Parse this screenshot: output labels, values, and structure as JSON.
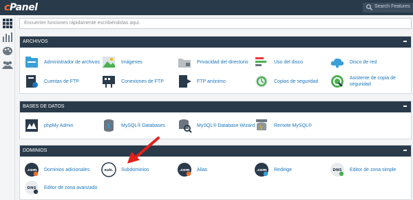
{
  "topbar": {
    "logo": "cPanel",
    "search_placeholder": "Search Features"
  },
  "main_search": {
    "placeholder": "Encuentre funciones rápidamente escribiéndolas aquí."
  },
  "sections": [
    {
      "title": "ARCHIVOS",
      "items": [
        {
          "label": "Administrador de archivos",
          "icon": "file-manager-icon"
        },
        {
          "label": "Imágenes",
          "icon": "images-icon"
        },
        {
          "label": "Privacidad del directorio",
          "icon": "folder-privacy-icon"
        },
        {
          "label": "Uso del disco",
          "icon": "disk-usage-icon"
        },
        {
          "label": "Disco de red",
          "icon": "cloud-disk-icon"
        },
        {
          "label": "Cuentas de FTP",
          "icon": "ftp-accounts-icon"
        },
        {
          "label": "Conexiones de FTP",
          "icon": "ftp-connections-icon"
        },
        {
          "label": "FTP anónimo",
          "icon": "anonymous-ftp-icon"
        },
        {
          "label": "Copias de seguridad",
          "icon": "backup-icon"
        },
        {
          "label": "Asistente de copia de seguridad",
          "icon": "backup-wizard-icon"
        }
      ]
    },
    {
      "title": "BASES DE DATOS",
      "items": [
        {
          "label": "phpMy Admin",
          "icon": "phpmyadmin-icon"
        },
        {
          "label": "MySQL® Databases",
          "icon": "mysql-databases-icon"
        },
        {
          "label": "MySQL® Database Wizard",
          "icon": "mysql-wizard-icon"
        },
        {
          "label": "Remote MySQL®",
          "icon": "remote-mysql-icon"
        }
      ]
    },
    {
      "title": "DOMINIOS",
      "items": [
        {
          "label": "Dominios adicionales",
          "icon": "addon-domains-icon",
          "badge": ".com"
        },
        {
          "label": "Subdominios",
          "icon": "subdomains-icon",
          "badge": "sub."
        },
        {
          "label": "Alias",
          "icon": "aliases-icon",
          "badge": ".com"
        },
        {
          "label": "Redirige",
          "icon": "redirects-icon",
          "badge": ".com"
        },
        {
          "label": "Editor de zona simple",
          "icon": "simple-zone-editor-icon",
          "badge": "DNS"
        },
        {
          "label": "Editor de zona avanzado",
          "icon": "advanced-zone-editor-icon",
          "badge": "DNS"
        }
      ]
    }
  ],
  "colors": {
    "header_bg": "#293a4a",
    "link": "#1b76bc",
    "brand_orange": "#ff6c2c",
    "arrow_red": "#e3201b"
  }
}
